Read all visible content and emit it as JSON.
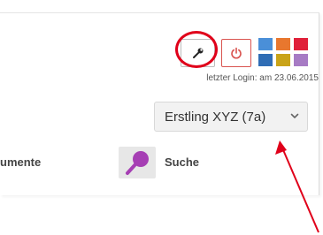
{
  "header": {
    "tools_icon": "wrench-icon",
    "power_icon": "power-icon",
    "app_tiles": [
      "#4a8fd8",
      "#e8772e",
      "#e0203a",
      "#2f6db5",
      "#c9a318",
      "#a77bc4"
    ],
    "last_login_text": "letzter Login: am 23.06.2015"
  },
  "student_select": {
    "value": "Erstling XYZ (7a)"
  },
  "nav": {
    "documents_label": "umente",
    "search_label": "Suche",
    "search_icon": "search-magnifier-icon"
  },
  "colors": {
    "annotation_red": "#e0001a",
    "power_red": "#d9534f",
    "search_icon_purple": "#a63fb4"
  }
}
